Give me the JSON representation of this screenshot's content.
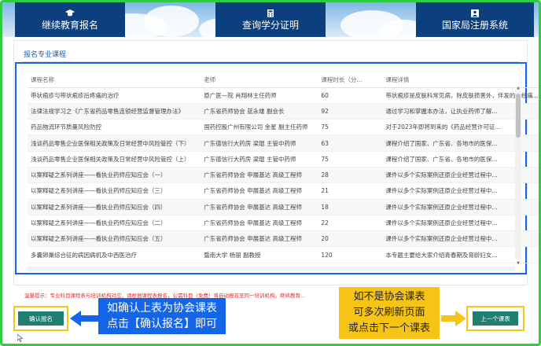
{
  "tabs": [
    {
      "label": "继续教育报名",
      "icon": "graduation-cap-icon"
    },
    {
      "label": "查询学分证明",
      "icon": "calculator-icon"
    },
    {
      "label": "国家局注册系统",
      "icon": "user-card-icon"
    }
  ],
  "panel": {
    "title": "报名专业课程"
  },
  "table": {
    "headers": [
      "课程名称",
      "老师",
      "课程时长（分...",
      "课程详情"
    ],
    "rows": [
      [
        "带状疱疹与带状疱疹后疼痛的治疗",
        "原广医—院 肖翔林主任药师",
        "60",
        "带状疱疹是皮肤科常见病，除皮肤损害外，伴发的神经痛..."
      ],
      [
        "法律法规学习之《广东省药品零售连锁经营监督管理办法》",
        "广东省药师协会 蓝永雄 副会长",
        "92",
        "通过学习和掌握本办法，让执业药师了解..."
      ],
      [
        "药品物流环节质量风险防控",
        "国药控股广州有限公司 金星 副主任药师",
        "75",
        "对于2023年即将到来的《药品经营许可证..."
      ],
      [
        "浅谈药品零售企业医保相关政策及日常经营中风险管控（下）",
        "广东德信行大药房 梁琨 主管中药师",
        "63",
        "课程介绍了国家、广东省、各地市的医保..."
      ],
      [
        "浅谈药品零售企业医保相关政策及日常经营中风险管控（上）",
        "广东德信行大药房 梁琨 主管中药师",
        "75",
        "课程介绍了国家、广东省、各地市的医保..."
      ],
      [
        "以案释疑之系列讲座——看执业药师应知应会（一）",
        "广东省药师协会 申展基达 高级工程师",
        "28",
        "课件以多个实际案例还原企业经营过程中..."
      ],
      [
        "以案释疑之系列讲座——看执业药师应知应会（三）",
        "广东省药师协会 申展基达 高级工程师",
        "21",
        "课件以多个实际案例还原企业经营过程中..."
      ],
      [
        "以案释疑之系列讲座——看执业药师应知应会（四）",
        "广东省药师协会 申展基达 高级工程师",
        "18",
        "课件以多个实际案例还原企业经营过程中..."
      ],
      [
        "以案释疑之系列讲座——看执业药师应知应会（二）",
        "广东省药师协会 申展基达 高级工程师",
        "22",
        "课件以多个实际案例还原企业经营过程中..."
      ],
      [
        "以案释疑之系列讲座——看执业药师应知应会（五）",
        "广东省药师协会 申展基达 高级工程师",
        "20",
        "课件以多个实际案例还原企业经营过程中..."
      ],
      [
        "多囊卵巢综合征的病因病机及中西医治疗",
        "暨南大学 杨丽 副教授",
        "120",
        "本专题主要给大家介绍青春期及育龄妇女..."
      ]
    ]
  },
  "tip": "温馨提示：专业科目课程表与培训机构对应，请根据课程表报名，公需科目（免费）将自动报名至同一培训机构。继续教育...",
  "buttons": {
    "confirm": "确认报名",
    "next": "上一个课表"
  },
  "annotations": {
    "left": [
      "如确认上表为协会课表",
      "点击【确认报名】即可"
    ],
    "right": [
      "如不是协会课表",
      "可多次刷新页面",
      "或点击下一个课表"
    ]
  },
  "colors": {
    "nav": "#0b3f7d",
    "button": "#1f7f70",
    "annotation_blue": "#1565e8",
    "annotation_yellow": "#f6c417",
    "frame": "#2ecc40"
  }
}
